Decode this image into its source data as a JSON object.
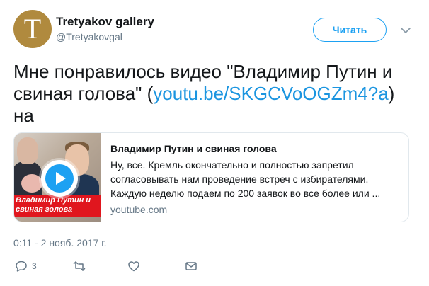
{
  "header": {
    "avatar_letter": "T",
    "display_name": "Tretyakov gallery",
    "handle": "@Tretyakovgal",
    "follow_label": "Читать",
    "caret_icon": "chevron-down-icon"
  },
  "tweet": {
    "text_before": "Мне понравилось видео \"Владимир Путин и свиная голова\" (",
    "link_text": "youtu.be/SKGCVoOGZm4?a",
    "text_after": ") на"
  },
  "card": {
    "thumb_banner": "Владимир Путин и свиная голова",
    "title": "Владимир Путин и свиная голова",
    "description": "Ну, все. Кремль окончательно и полностью запретил согласовывать нам проведение встреч с избирателями. Каждую неделю подаем по 200 заявок во все более или ...",
    "domain": "youtube.com"
  },
  "timestamp": "0:11 - 2 нояб. 2017 г.",
  "actions": {
    "reply_count": "3",
    "retweet_count": "",
    "like_count": ""
  },
  "colors": {
    "accent": "#1da1f2",
    "link": "#1b95e0",
    "muted": "#657786",
    "avatar": "#b08a3e",
    "banner": "#e0161e"
  }
}
